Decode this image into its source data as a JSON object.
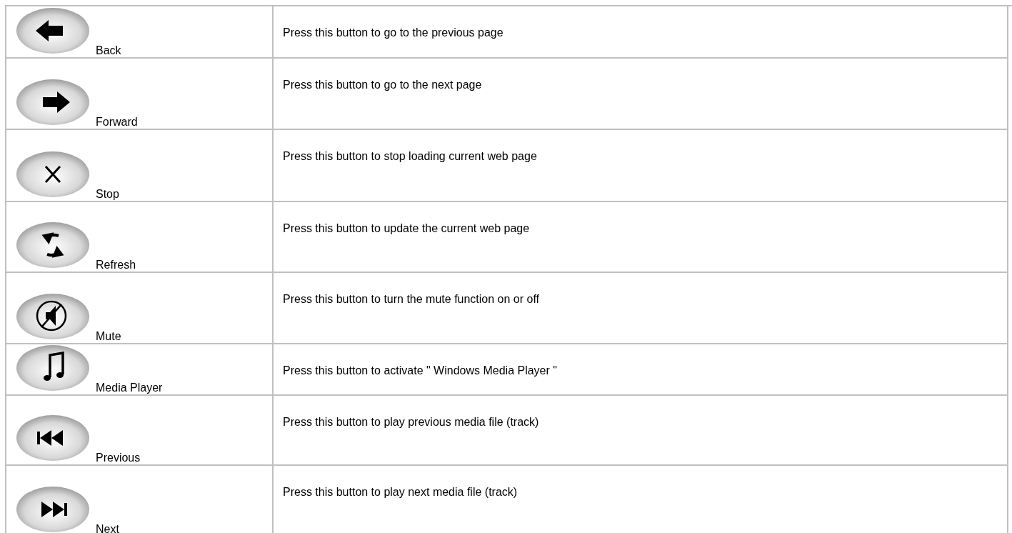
{
  "rows": [
    {
      "kind": "back",
      "label": "Back",
      "description": "Press this button to go to the previous page"
    },
    {
      "kind": "forward",
      "label": "Forward",
      "description": "Press this button to go to the next page"
    },
    {
      "kind": "stop",
      "label": "Stop",
      "description": "Press this button to stop loading current web page"
    },
    {
      "kind": "refresh",
      "label": "Refresh",
      "description": "Press this button to update the current web page"
    },
    {
      "kind": "mute",
      "label": "Mute",
      "description": "Press this button to turn the mute function on or off"
    },
    {
      "kind": "music",
      "label": "Media Player",
      "description": "Press this button to activate \" Windows Media Player \""
    },
    {
      "kind": "previous",
      "label": "Previous",
      "description": "Press this button to play previous media file (track)"
    },
    {
      "kind": "next",
      "label": "Next",
      "description": "Press this button to play next media file (track)"
    }
  ]
}
